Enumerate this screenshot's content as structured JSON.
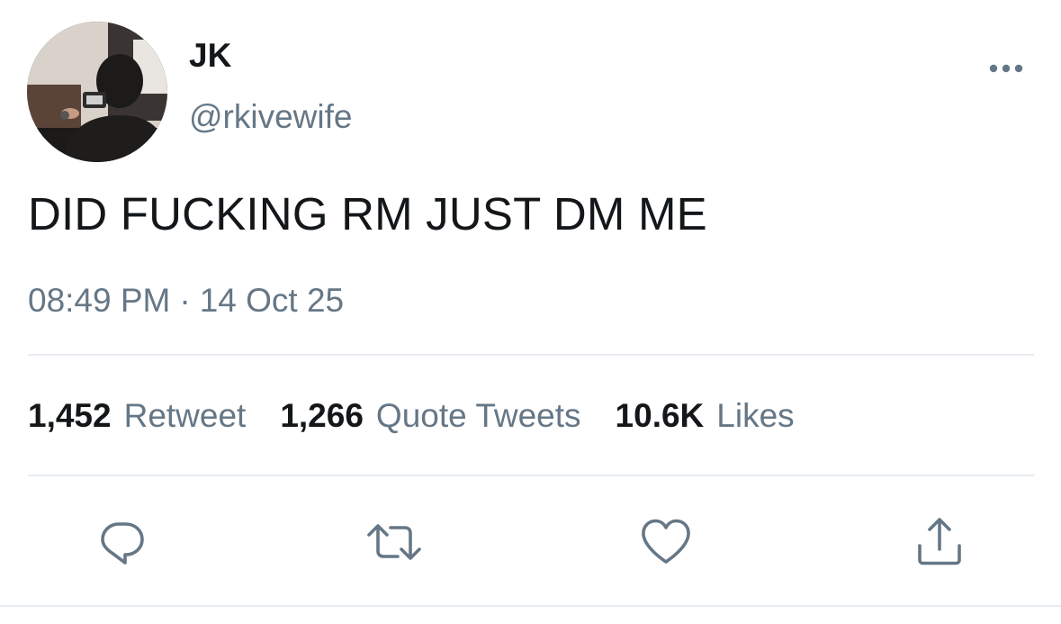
{
  "user": {
    "display_name": "JK",
    "handle": "@rkivewife",
    "avatar_icon": "avatar-photo"
  },
  "tweet": {
    "text": "DID FUCKING RM JUST DM ME",
    "time": "08:49 PM",
    "separator": "·",
    "date": "14 Oct 25"
  },
  "stats": [
    {
      "count": "1,452",
      "label": "Retweet"
    },
    {
      "count": "1,266",
      "label": "Quote Tweets"
    },
    {
      "count": "10.6K",
      "label": "Likes"
    }
  ],
  "actions": {
    "reply_icon": "reply-icon",
    "retweet_icon": "retweet-icon",
    "like_icon": "heart-icon",
    "share_icon": "share-icon"
  },
  "colors": {
    "text_primary": "#14171a",
    "text_secondary": "#657786",
    "divider": "#e6ecf0"
  }
}
